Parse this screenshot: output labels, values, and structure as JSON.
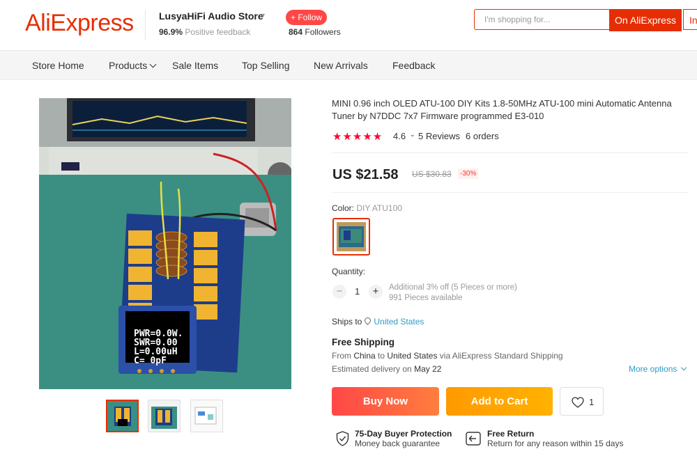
{
  "header": {
    "logo": "AliExpress",
    "store_name": "LusyaHiFi Audio Store",
    "feedback_pct": "96.9%",
    "feedback_label": "Positive feedback",
    "follow_label": "+ Follow",
    "followers_count": "864",
    "followers_label": "Followers",
    "search_placeholder": "I'm shopping for...",
    "search_on_ali": "On AliExpress",
    "search_in_store": "In"
  },
  "nav": {
    "items": [
      "Store Home",
      "Products",
      "Sale Items",
      "Top Selling",
      "New Arrivals",
      "Feedback"
    ]
  },
  "product": {
    "title": "MINI 0.96 inch OLED ATU-100 DIY Kits 1.8-50MHz ATU-100 mini Automatic Antenna Tuner by N7DDC 7x7 Firmware programmed E3-010",
    "stars": "★★★★★",
    "rating": "4.6",
    "reviews": "5 Reviews",
    "orders": "6 orders",
    "price": "US $21.58",
    "original_price": "US $30.83",
    "discount": "-30%",
    "color_label": "Color:",
    "color_value": "DIY ATU100",
    "quantity_label": "Quantity:",
    "quantity_value": "1",
    "qty_minus": "−",
    "qty_plus": "+",
    "qty_discount_note": "Additional 3% off (5 Pieces or more)",
    "qty_available": "991 Pieces available",
    "oled_lines": [
      "PWR=0.0W.",
      "SWR=0.00",
      "L=0.00uH",
      "C=    0pF"
    ]
  },
  "shipping": {
    "ships_to_label": "Ships to",
    "ships_to_value": "United States",
    "free_shipping": "Free Shipping",
    "from_label": "From",
    "from_value": "China",
    "to_label": "to",
    "to_value": "United States",
    "via_text": "via AliExpress Standard Shipping",
    "delivery_label": "Estimated delivery on",
    "delivery_date": "May 22",
    "more_options": "More options"
  },
  "actions": {
    "buy_now": "Buy Now",
    "add_to_cart": "Add to Cart",
    "wishlist_count": "1"
  },
  "protection": {
    "buyer_title": "75-Day Buyer Protection",
    "buyer_sub": "Money back guarantee",
    "return_title": "Free Return",
    "return_sub": "Return for any reason within 15 days"
  },
  "colors": {
    "brand": "#e62e04",
    "link": "#2e9cc3",
    "star": "#ff0033"
  }
}
